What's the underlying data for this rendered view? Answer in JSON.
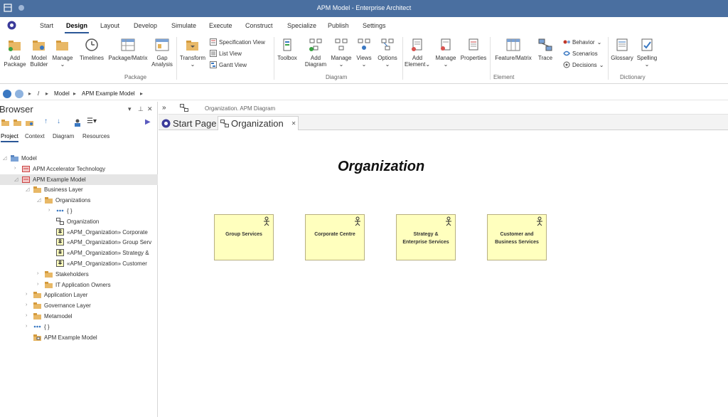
{
  "window": {
    "title": "APM Model - Enterprise Architect"
  },
  "ribbon_tabs": [
    "Start",
    "Design",
    "Layout",
    "Develop",
    "Simulate",
    "Execute",
    "Construct",
    "Specialize",
    "Publish",
    "Settings"
  ],
  "active_tab": "Design",
  "ribbon": {
    "package_group": {
      "label": "Package",
      "add_package": "Add\nPackage",
      "model_builder": "Model\nBuilder",
      "manage": "Manage",
      "timelines": "Timelines",
      "package_matrix": "Package/Matrix",
      "gap_analysis": "Gap\nAnalysis"
    },
    "transform_group": {
      "transform": "Transform",
      "specification_view": "Specification View",
      "list_view": "List View",
      "gantt_view": "Gantt View"
    },
    "diagram_group": {
      "label": "Diagram",
      "toolbox": "Toolbox",
      "add_diagram": "Add\nDiagram",
      "manage": "Manage",
      "views": "Views",
      "options": "Options"
    },
    "element_group": {
      "label": "Element",
      "add_element": "Add\nElement",
      "manage": "Manage",
      "properties": "Properties",
      "feature_matrix": "Feature/Matrix",
      "trace": "Trace",
      "behavior": "Behavior",
      "scenarios": "Scenarios",
      "decisions": "Decisions"
    },
    "dictionary_group": {
      "label": "Dictionary",
      "glossary": "Glossary",
      "spelling": "Spelling"
    }
  },
  "address_bar": {
    "root": "/",
    "crumbs": [
      "Model",
      "APM Example Model"
    ]
  },
  "browser": {
    "title": "Browser",
    "tabs": [
      "Project",
      "Context",
      "Diagram",
      "Resources"
    ],
    "active_tab": "Project",
    "tree": [
      {
        "label": "Model",
        "indent": 0,
        "icon": "model-icon",
        "twisty": "expanded"
      },
      {
        "label": "APM Accelerator Technology",
        "indent": 1,
        "icon": "package-red-icon",
        "twisty": "collapsed"
      },
      {
        "label": "APM Example Model",
        "indent": 1,
        "icon": "package-red-icon",
        "twisty": "expanded",
        "selected": true
      },
      {
        "label": "Business Layer",
        "indent": 2,
        "icon": "folder-icon",
        "twisty": "expanded"
      },
      {
        "label": "Organizations",
        "indent": 3,
        "icon": "folder-icon",
        "twisty": "expanded"
      },
      {
        "label": "{ }",
        "indent": 4,
        "icon": "dots-icon",
        "twisty": "collapsed"
      },
      {
        "label": "Organization",
        "indent": 4,
        "icon": "diagram-icon",
        "twisty": ""
      },
      {
        "label": "«APM_Organization» Corporate",
        "indent": 4,
        "icon": "actor-element-icon",
        "twisty": ""
      },
      {
        "label": "«APM_Organization» Group Serv",
        "indent": 4,
        "icon": "actor-element-icon",
        "twisty": ""
      },
      {
        "label": "«APM_Organization» Strategy &",
        "indent": 4,
        "icon": "actor-element-icon",
        "twisty": ""
      },
      {
        "label": "«APM_Organization» Customer",
        "indent": 4,
        "icon": "actor-element-icon",
        "twisty": ""
      },
      {
        "label": "Stakeholders",
        "indent": 3,
        "icon": "folder-icon",
        "twisty": "collapsed"
      },
      {
        "label": "IT Application Owners",
        "indent": 3,
        "icon": "folder-icon",
        "twisty": "collapsed"
      },
      {
        "label": "Application Layer",
        "indent": 2,
        "icon": "folder-icon",
        "twisty": "collapsed"
      },
      {
        "label": "Governance Layer",
        "indent": 2,
        "icon": "folder-icon",
        "twisty": "collapsed"
      },
      {
        "label": "Metamodel",
        "indent": 2,
        "icon": "folder-icon",
        "twisty": "collapsed"
      },
      {
        "label": "{ }",
        "indent": 2,
        "icon": "dots-icon",
        "twisty": "collapsed"
      },
      {
        "label": "APM Example Model",
        "indent": 2,
        "icon": "package-diagram-icon",
        "twisty": ""
      }
    ]
  },
  "main": {
    "diagram_path": "Organization.  APM Diagram",
    "doc_tabs": [
      {
        "label": "Start Page",
        "icon": "start-page-icon",
        "active": false
      },
      {
        "label": "Organization",
        "icon": "diagram-icon",
        "active": true
      }
    ],
    "close_glyph": "✕",
    "diagram_title": "Organization",
    "elements": [
      {
        "label": "Group Services"
      },
      {
        "label": "Corporate Centre"
      },
      {
        "label": "Strategy &\nEnterprise Services"
      },
      {
        "label": "Customer and\nBusiness Services"
      }
    ]
  },
  "colors": {
    "titlebar": "#4a6fa0",
    "element_fill": "#ffffbe",
    "accent": "#2b5797"
  }
}
